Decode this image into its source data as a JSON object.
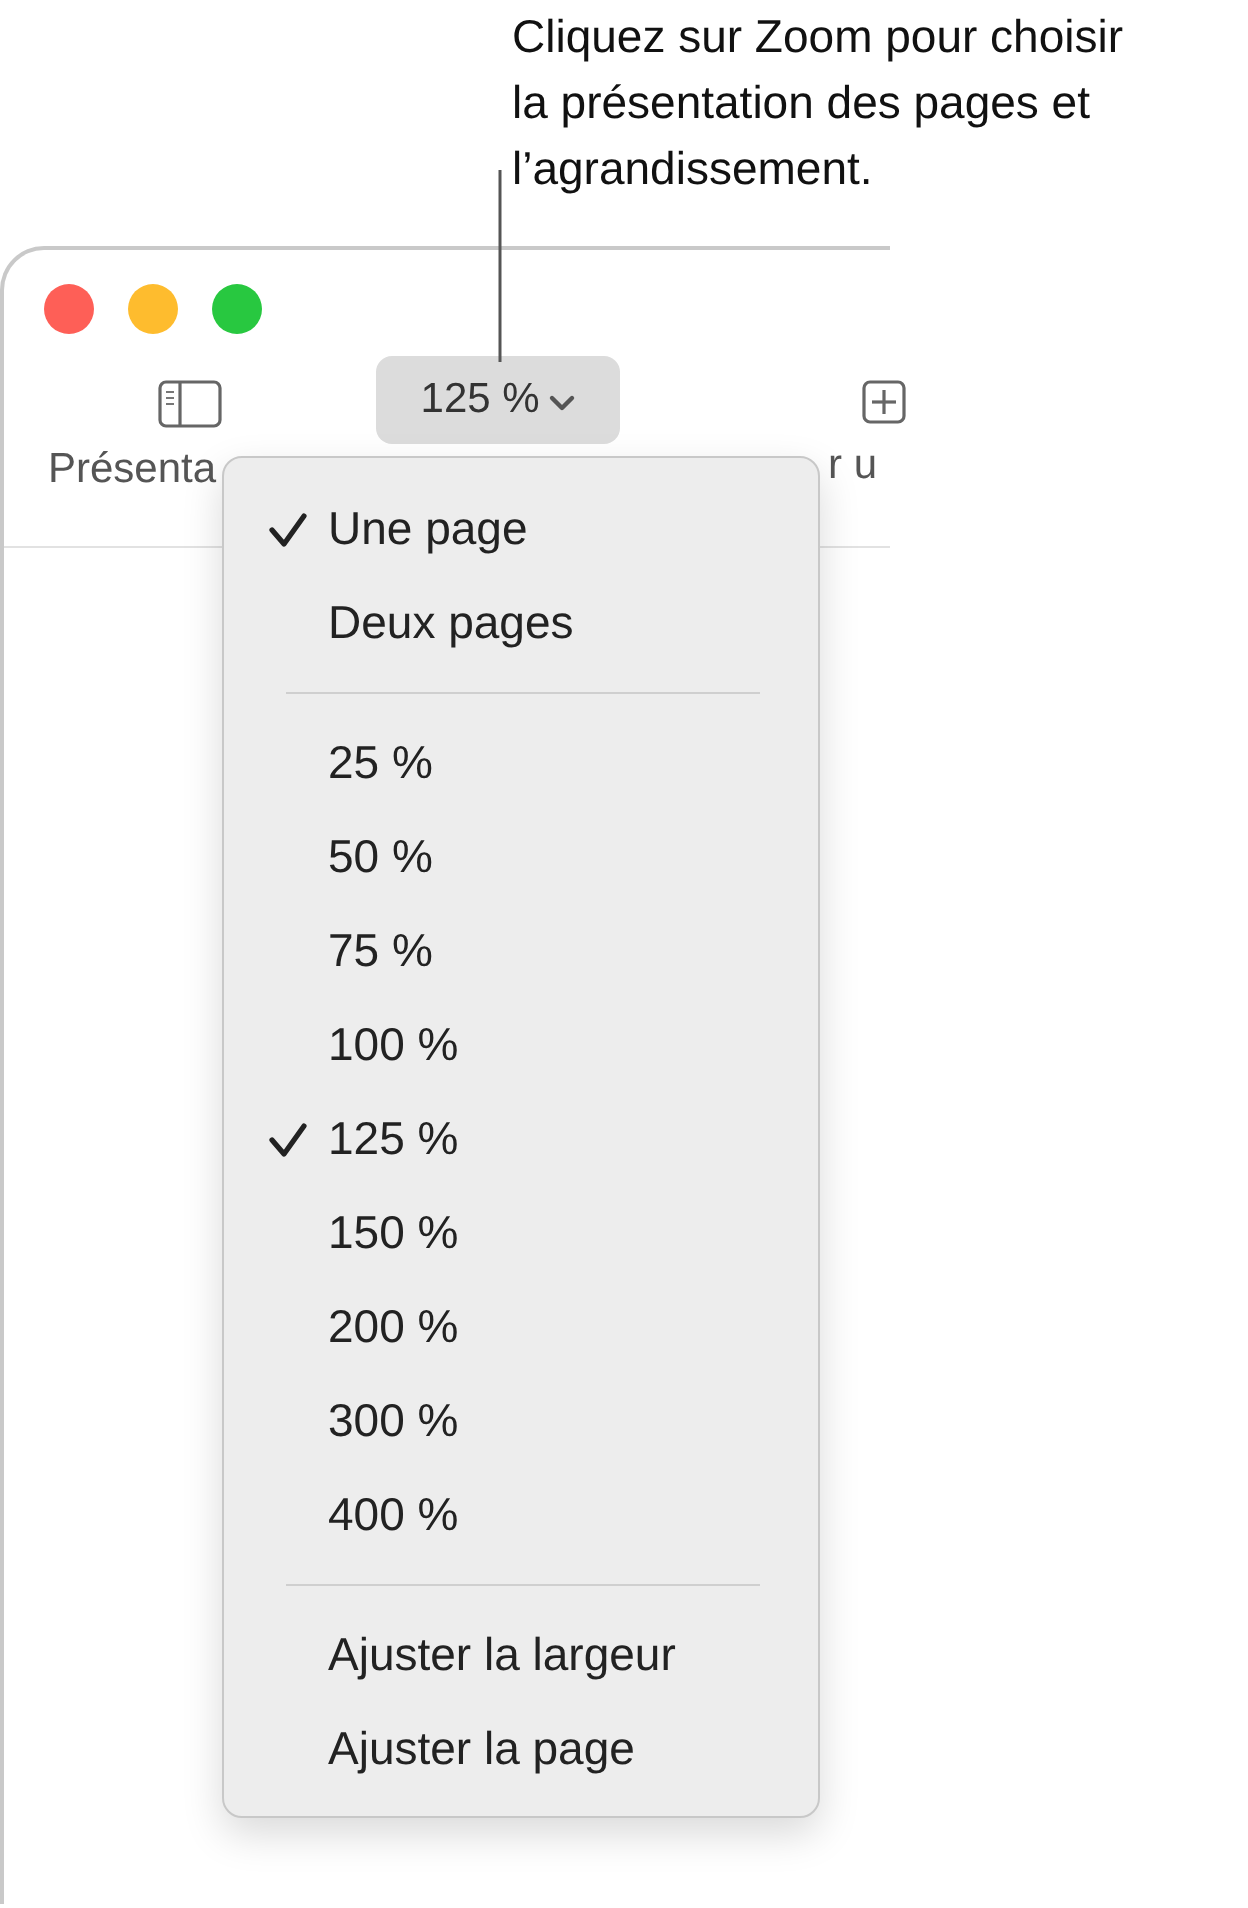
{
  "callout": {
    "text": "Cliquez sur Zoom pour choisir la présentation des pages et l’agrandissement."
  },
  "window": {
    "toolbar": [
      {
        "kind": "sidebar",
        "label": "Présenta"
      },
      {
        "kind": "zoom",
        "label": "125 %"
      },
      {
        "kind": "add",
        "label": "r u"
      }
    ]
  },
  "menu": {
    "items": [
      {
        "kind": "option",
        "label": "Une page",
        "checked": true
      },
      {
        "kind": "option",
        "label": "Deux pages",
        "checked": false
      },
      {
        "kind": "separator"
      },
      {
        "kind": "option",
        "label": "25 %",
        "checked": false
      },
      {
        "kind": "option",
        "label": "50 %",
        "checked": false
      },
      {
        "kind": "option",
        "label": "75 %",
        "checked": false
      },
      {
        "kind": "option",
        "label": "100 %",
        "checked": false
      },
      {
        "kind": "option",
        "label": "125 %",
        "checked": true
      },
      {
        "kind": "option",
        "label": "150 %",
        "checked": false
      },
      {
        "kind": "option",
        "label": "200 %",
        "checked": false
      },
      {
        "kind": "option",
        "label": "300 %",
        "checked": false
      },
      {
        "kind": "option",
        "label": "400 %",
        "checked": false
      },
      {
        "kind": "separator"
      },
      {
        "kind": "option",
        "label": "Ajuster la largeur",
        "checked": false
      },
      {
        "kind": "option",
        "label": "Ajuster la page",
        "checked": false
      }
    ]
  }
}
